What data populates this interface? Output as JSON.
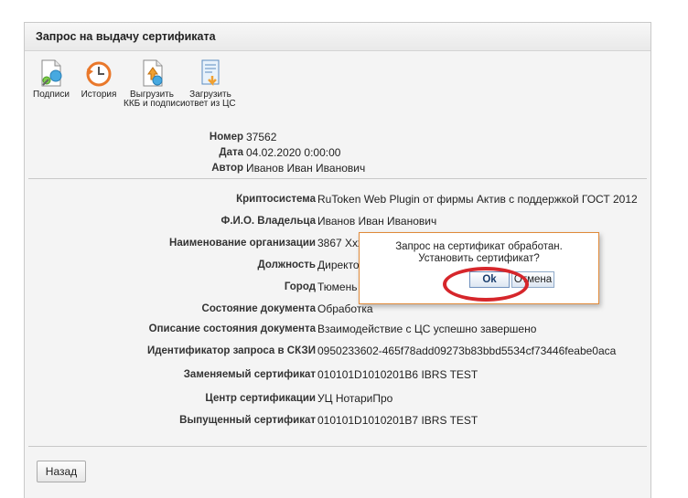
{
  "panel": {
    "title": "Запрос на выдачу сертификата"
  },
  "toolbar": [
    {
      "label": "Подписи",
      "icon": "signatures-icon"
    },
    {
      "label": "История",
      "icon": "history-icon"
    },
    {
      "label": "Выгрузить\nККБ и подписи",
      "icon": "export-icon"
    },
    {
      "label": "Загрузить\nответ из ЦС",
      "icon": "import-response-icon"
    }
  ],
  "header_fields": [
    {
      "label": "Номер",
      "value": "37562"
    },
    {
      "label": "Дата",
      "value": "04.02.2020 0:00:00"
    },
    {
      "label": "Автор",
      "value": "Иванов Иван Иванович"
    }
  ],
  "fields": [
    {
      "label": "Криптосистема",
      "value": "RuToken Web Plugin от фирмы Актив с поддержкой ГОСТ 2012"
    },
    {
      "label": "Ф.И.О. Владельца",
      "value": "Иванов Иван Иванович"
    },
    {
      "label": "Наименование организации",
      "value": "3867 Xxxxxxxxx"
    },
    {
      "label": "Должность",
      "value": "Директор"
    },
    {
      "label": "Город",
      "value": "Тюмень"
    },
    {
      "label": "Состояние документа",
      "value": "Обработка"
    },
    {
      "label": "Описание состояния документа",
      "value": "Взаимодействие с ЦС успешно завершено"
    },
    {
      "label": "Идентификатор запроса в СКЗИ",
      "value": "0950233602-465f78add09273b83bbd5534cf73446feabe0aca"
    },
    {
      "label": "Заменяемый сертификат",
      "value": "010101D1010201B6 IBRS TEST"
    },
    {
      "label": "Центр сертификации",
      "value": "УЦ НотариПро"
    },
    {
      "label": "Выпущенный сертификат",
      "value": "010101D1010201B7 IBRS TEST"
    }
  ],
  "dialog": {
    "line1": "Запрос на сертификат обработан.",
    "line2": "Установить сертификат?",
    "ok_label": "Ok",
    "cancel_label": "Отмена"
  },
  "footer": {
    "back_label": "Назад"
  },
  "colors": {
    "highlight": "#d6262b",
    "dialog_border": "#e08a3a"
  }
}
